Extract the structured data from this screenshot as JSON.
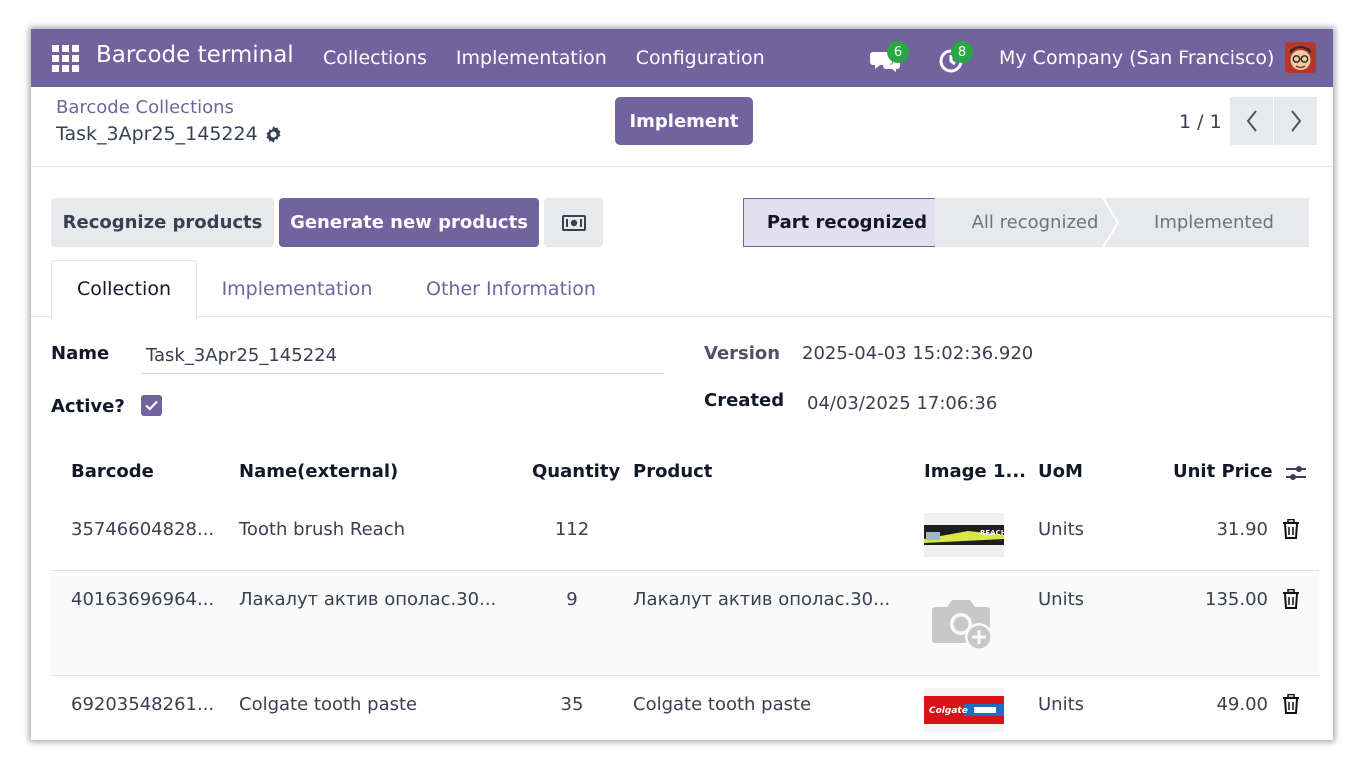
{
  "navbar": {
    "brand": "Barcode terminal",
    "menu": [
      "Collections",
      "Implementation",
      "Configuration"
    ],
    "messages_badge": "6",
    "activities_badge": "8",
    "company": "My Company (San Francisco)"
  },
  "control": {
    "breadcrumb": "Barcode Collections",
    "record_name": "Task_3Apr25_145224",
    "implement_label": "Implement",
    "pager": "1 / 1"
  },
  "buttons": {
    "recognize": "Recognize products",
    "generate": "Generate new products"
  },
  "status": {
    "stages": [
      "Part recognized",
      "All recognized",
      "Implemented"
    ],
    "active_index": 0
  },
  "tabs": [
    "Collection",
    "Implementation",
    "Other Information"
  ],
  "fields": {
    "name_label": "Name",
    "name_value": "Task_3Apr25_145224",
    "active_label": "Active?",
    "active_checked": true,
    "version_label": "Version",
    "version_value": "2025-04-03 15:02:36.920",
    "created_label": "Created",
    "created_value": "04/03/2025 17:06:36"
  },
  "table": {
    "headers": [
      "Barcode",
      "Name(external)",
      "Quantity",
      "Product",
      "Image 1...",
      "UoM",
      "Unit Price"
    ],
    "rows": [
      {
        "barcode": "35746604828...",
        "name": "Tooth brush Reach",
        "quantity": "112",
        "product": "",
        "image": "reach-toothbrush",
        "uom": "Units",
        "price": "31.90"
      },
      {
        "barcode": "40163696964...",
        "name": "Лакалут актив ополас.30...",
        "quantity": "9",
        "product": "Лакалут актив ополас.30...",
        "image": "placeholder",
        "uom": "Units",
        "price": "135.00"
      },
      {
        "barcode": "69203548261...",
        "name": "Colgate tooth paste",
        "quantity": "35",
        "product": "Colgate tooth paste",
        "image": "colgate-paste",
        "uom": "Units",
        "price": "49.00"
      }
    ]
  },
  "colors": {
    "brand": "#71639e",
    "badge": "#28a745"
  }
}
